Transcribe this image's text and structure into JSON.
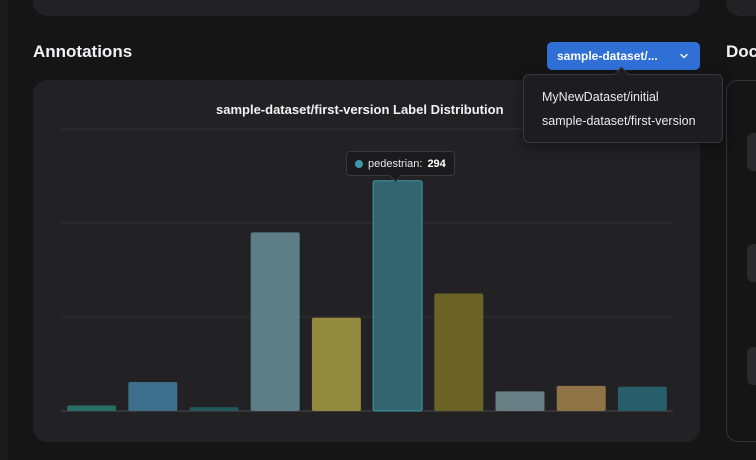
{
  "annotations": {
    "title": "Annotations",
    "selected_dataset": "sample-dataset/...",
    "dropdown_options": [
      "MyNewDataset/initial",
      "sample-dataset/first-version"
    ]
  },
  "right_section": {
    "title_partial": "Doc"
  },
  "tooltip": {
    "label": "pedestrian:",
    "value": "294",
    "color": "#3f97ad"
  },
  "chart_data": {
    "type": "bar",
    "title": "sample-dataset/first-version Label Distribution",
    "xlabel": "",
    "ylabel": "",
    "ylim": [
      0,
      360
    ],
    "grid": true,
    "values": [
      7,
      37,
      5,
      228,
      119,
      294,
      150,
      25,
      32,
      31
    ],
    "colors": [
      "#2a6e6a",
      "#3d6f8c",
      "#22585a",
      "#5d7d87",
      "#928a3d",
      "#33656f",
      "#6b6325",
      "#667e84",
      "#8f7347",
      "#275e6a"
    ],
    "highlight_index": 5
  }
}
